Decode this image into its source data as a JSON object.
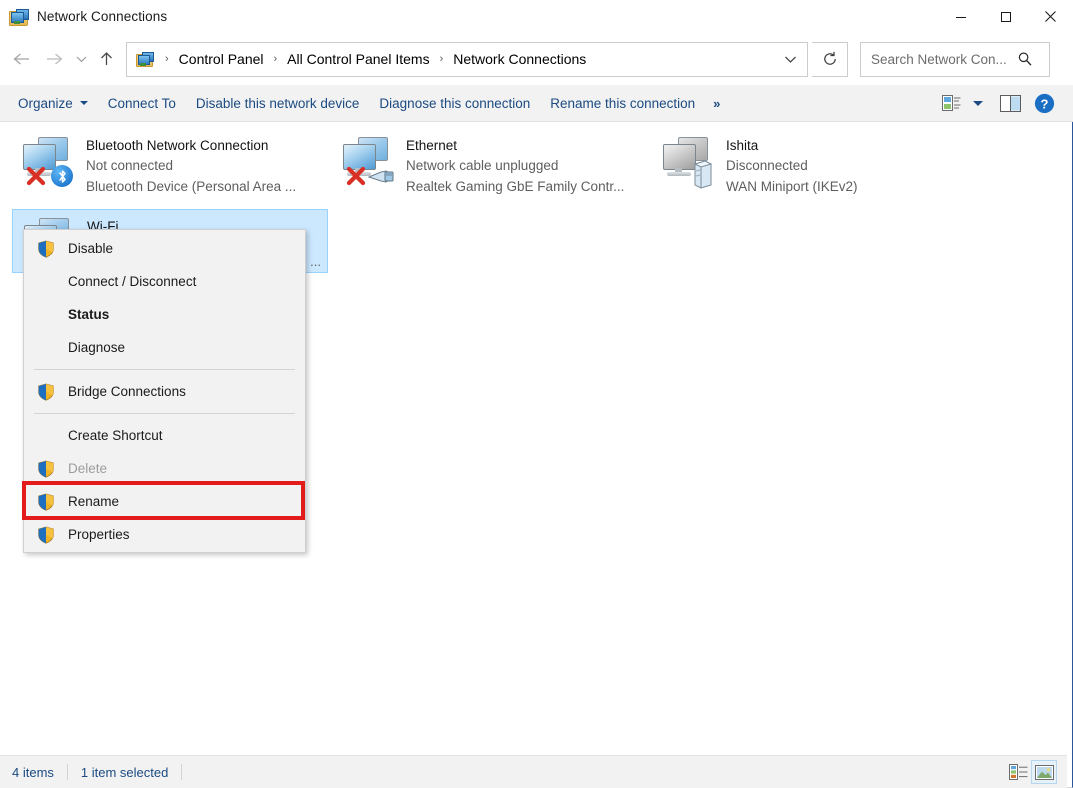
{
  "window": {
    "title": "Network Connections",
    "title_icon": "network-folder-icon",
    "controls": {
      "minimize": "minimize-button",
      "maximize": "maximize-button",
      "close": "close-button"
    }
  },
  "addressbar": {
    "back": "back-icon",
    "forward": "forward-icon",
    "recent": "recent-locations-icon",
    "up": "up-icon",
    "crumb_icon": "network-folder-icon",
    "breadcrumbs": [
      {
        "label": "Control Panel"
      },
      {
        "label": "All Control Panel Items"
      },
      {
        "label": "Network Connections"
      }
    ],
    "separator": "›",
    "dropdown": "previous-locations-icon",
    "refresh": "refresh-icon"
  },
  "search": {
    "value": "",
    "placeholder": "Search Network Con...",
    "icon": "search-icon"
  },
  "toolbar": {
    "items": [
      {
        "label": "Organize",
        "has_caret": true
      },
      {
        "label": "Connect To",
        "has_caret": false
      },
      {
        "label": "Disable this network device",
        "has_caret": false
      },
      {
        "label": "Diagnose this connection",
        "has_caret": false
      },
      {
        "label": "Rename this connection",
        "has_caret": false
      }
    ],
    "overflow": "»",
    "view_icon": "change-view-icon",
    "preview_icon": "preview-pane-icon",
    "help_icon": "help-icon"
  },
  "connections": [
    {
      "name": "Bluetooth Network Connection",
      "status": "Not connected",
      "device": "Bluetooth Device (Personal Area ...",
      "icon": "network-adapter-icon",
      "badge": "bluetooth-badge-icon",
      "error_overlay": "red-x-icon",
      "selected": false,
      "enabled": true
    },
    {
      "name": "Ethernet",
      "status": "Network cable unplugged",
      "device": "Realtek Gaming GbE Family Contr...",
      "icon": "network-adapter-icon",
      "badge": "ethernet-cable-badge-icon",
      "error_overlay": "red-x-icon",
      "selected": false,
      "enabled": true
    },
    {
      "name": "Ishita",
      "status": "Disconnected",
      "device": "WAN Miniport (IKEv2)",
      "icon": "vpn-adapter-icon",
      "badge": "server-badge-icon",
      "error_overlay": "",
      "selected": false,
      "enabled": false
    },
    {
      "name": "Wi-Fi",
      "status": "",
      "device": "",
      "icon": "wifi-adapter-icon",
      "badge": "",
      "error_overlay": "",
      "selected": true,
      "enabled": true,
      "ellipsis": "..."
    }
  ],
  "context_menu": {
    "items": [
      {
        "label": "Disable",
        "shield": true,
        "bold": false,
        "disabled": false,
        "separator_after": false
      },
      {
        "label": "Connect / Disconnect",
        "shield": false,
        "bold": false,
        "disabled": false,
        "separator_after": false
      },
      {
        "label": "Status",
        "shield": false,
        "bold": true,
        "disabled": false,
        "separator_after": false
      },
      {
        "label": "Diagnose",
        "shield": false,
        "bold": false,
        "disabled": false,
        "separator_after": true
      },
      {
        "label": "Bridge Connections",
        "shield": true,
        "bold": false,
        "disabled": false,
        "separator_after": true
      },
      {
        "label": "Create Shortcut",
        "shield": false,
        "bold": false,
        "disabled": false,
        "separator_after": false
      },
      {
        "label": "Delete",
        "shield": true,
        "bold": false,
        "disabled": true,
        "separator_after": false
      },
      {
        "label": "Rename",
        "shield": true,
        "bold": false,
        "disabled": false,
        "separator_after": false
      },
      {
        "label": "Properties",
        "shield": true,
        "bold": false,
        "disabled": false,
        "separator_after": false
      }
    ],
    "highlighted_item": "Properties",
    "highlight_color": "#e21b1b"
  },
  "statusbar": {
    "item_count": "4 items",
    "selection": "1 item selected",
    "details_view_icon": "details-view-icon",
    "tiles_view_icon": "large-icons-view-icon"
  },
  "colors": {
    "accent": "#1b4b82",
    "selection_fill": "#cce8ff",
    "selection_border": "#99d1ff",
    "toolbar_bg": "#f2f2f2",
    "highlight": "#e21b1b"
  }
}
